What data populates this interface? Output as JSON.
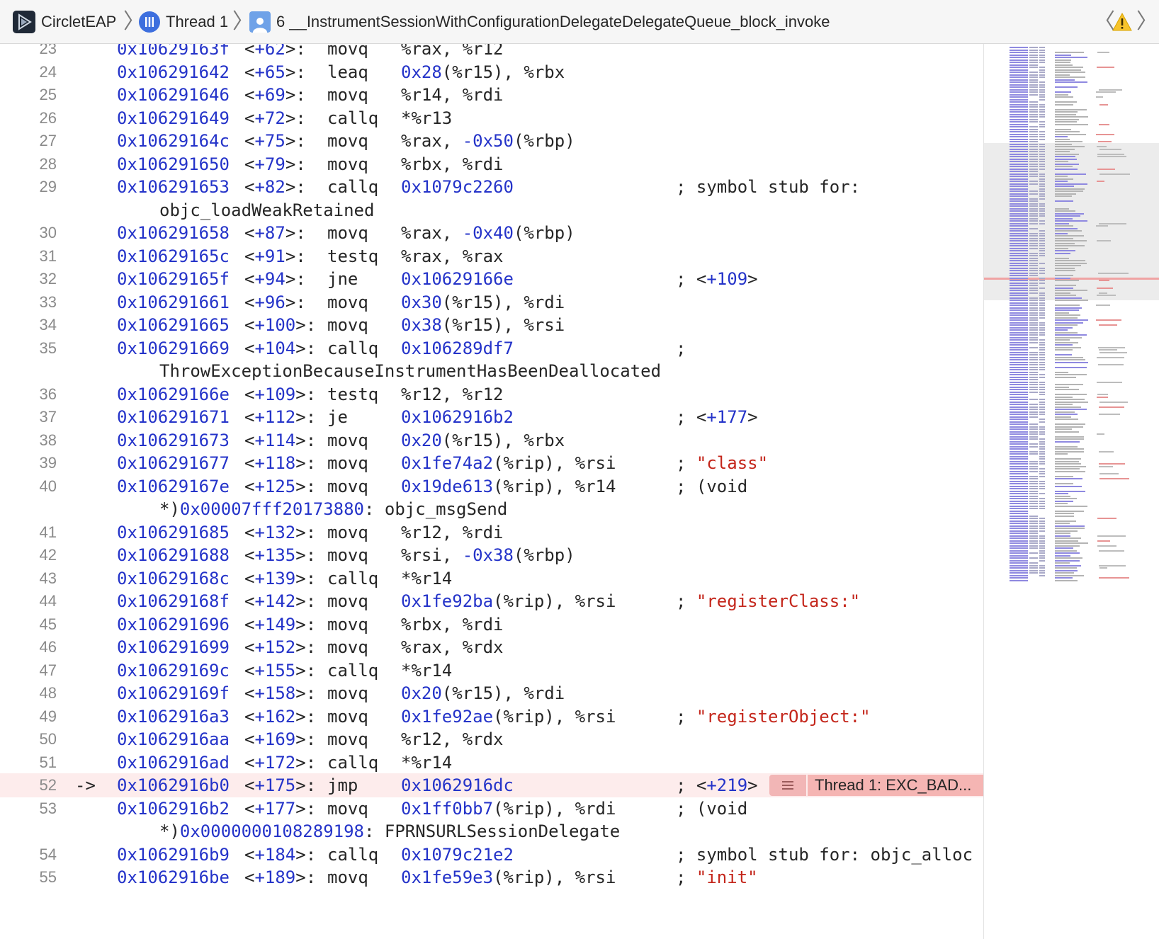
{
  "jumpbar": {
    "app_name": "CircletEAP",
    "thread_label": "Thread 1",
    "frame_label": "6 __InstrumentSessionWithConfigurationDelegateDelegateQueue_block_invoke"
  },
  "colors": {
    "address": "#2433c9",
    "string": "#c4261b",
    "highlight_row": "#fdecec",
    "error_badge": "#f5b5b3"
  },
  "lines": [
    {
      "num": "23",
      "addr": "0x10629163f",
      "off": "62",
      "mn": "movq",
      "ops": [
        [
          "t",
          "%rax, %r12"
        ]
      ]
    },
    {
      "num": "24",
      "addr": "0x106291642",
      "off": "65",
      "mn": "leaq",
      "ops": [
        [
          "n",
          "0x28"
        ],
        [
          "t",
          "(%r15), %rbx"
        ]
      ]
    },
    {
      "num": "25",
      "addr": "0x106291646",
      "off": "69",
      "mn": "movq",
      "ops": [
        [
          "t",
          "%r14, %rdi"
        ]
      ]
    },
    {
      "num": "26",
      "addr": "0x106291649",
      "off": "72",
      "mn": "callq",
      "ops": [
        [
          "t",
          "*%r13"
        ]
      ]
    },
    {
      "num": "27",
      "addr": "0x10629164c",
      "off": "75",
      "mn": "movq",
      "ops": [
        [
          "t",
          "%rax, "
        ],
        [
          "n",
          "-0x50"
        ],
        [
          "t",
          "(%rbp)"
        ]
      ]
    },
    {
      "num": "28",
      "addr": "0x106291650",
      "off": "79",
      "mn": "movq",
      "ops": [
        [
          "t",
          "%rbx, %rdi"
        ]
      ]
    },
    {
      "num": "29",
      "addr": "0x106291653",
      "off": "82",
      "mn": "callq",
      "ops": [
        [
          "n",
          "0x1079c2260"
        ]
      ],
      "cmt": [
        [
          "t",
          "; symbol stub for:"
        ]
      ],
      "cont": [
        [
          "t",
          "objc_loadWeakRetained"
        ]
      ]
    },
    {
      "num": "30",
      "addr": "0x106291658",
      "off": "87",
      "mn": "movq",
      "ops": [
        [
          "t",
          "%rax, "
        ],
        [
          "n",
          "-0x40"
        ],
        [
          "t",
          "(%rbp)"
        ]
      ]
    },
    {
      "num": "31",
      "addr": "0x10629165c",
      "off": "91",
      "mn": "testq",
      "ops": [
        [
          "t",
          "%rax, %rax"
        ]
      ]
    },
    {
      "num": "32",
      "addr": "0x10629165f",
      "off": "94",
      "mn": "jne",
      "ops": [
        [
          "n",
          "0x10629166e"
        ]
      ],
      "cmt": [
        [
          "t",
          "; <"
        ],
        [
          "n",
          "+109"
        ],
        [
          "t",
          ">"
        ]
      ]
    },
    {
      "num": "33",
      "addr": "0x106291661",
      "off": "96",
      "mn": "movq",
      "ops": [
        [
          "n",
          "0x30"
        ],
        [
          "t",
          "(%r15), %rdi"
        ]
      ]
    },
    {
      "num": "34",
      "addr": "0x106291665",
      "off": "100",
      "mn": "movq",
      "ops": [
        [
          "n",
          "0x38"
        ],
        [
          "t",
          "(%r15), %rsi"
        ]
      ]
    },
    {
      "num": "35",
      "addr": "0x106291669",
      "off": "104",
      "mn": "callq",
      "ops": [
        [
          "n",
          "0x106289df7"
        ]
      ],
      "cmt": [
        [
          "t",
          ";"
        ]
      ],
      "cont": [
        [
          "t",
          "ThrowExceptionBecauseInstrumentHasBeenDeallocated"
        ]
      ]
    },
    {
      "num": "36",
      "addr": "0x10629166e",
      "off": "109",
      "mn": "testq",
      "ops": [
        [
          "t",
          "%r12, %r12"
        ]
      ]
    },
    {
      "num": "37",
      "addr": "0x106291671",
      "off": "112",
      "mn": "je",
      "ops": [
        [
          "n",
          "0x1062916b2"
        ]
      ],
      "cmt": [
        [
          "t",
          "; <"
        ],
        [
          "n",
          "+177"
        ],
        [
          "t",
          ">"
        ]
      ]
    },
    {
      "num": "38",
      "addr": "0x106291673",
      "off": "114",
      "mn": "movq",
      "ops": [
        [
          "n",
          "0x20"
        ],
        [
          "t",
          "(%r15), %rbx"
        ]
      ]
    },
    {
      "num": "39",
      "addr": "0x106291677",
      "off": "118",
      "mn": "movq",
      "ops": [
        [
          "n",
          "0x1fe74a2"
        ],
        [
          "t",
          "(%rip), %rsi"
        ]
      ],
      "cmt": [
        [
          "t",
          "; "
        ],
        [
          "s",
          "\"class\""
        ]
      ]
    },
    {
      "num": "40",
      "addr": "0x10629167e",
      "off": "125",
      "mn": "movq",
      "ops": [
        [
          "n",
          "0x19de613"
        ],
        [
          "t",
          "(%rip), %r14"
        ]
      ],
      "cmt": [
        [
          "t",
          "; (void"
        ]
      ],
      "cont": [
        [
          "t",
          "*)"
        ],
        [
          "n",
          "0x00007fff20173880"
        ],
        [
          "t",
          ": objc_msgSend"
        ]
      ]
    },
    {
      "num": "41",
      "addr": "0x106291685",
      "off": "132",
      "mn": "movq",
      "ops": [
        [
          "t",
          "%r12, %rdi"
        ]
      ]
    },
    {
      "num": "42",
      "addr": "0x106291688",
      "off": "135",
      "mn": "movq",
      "ops": [
        [
          "t",
          "%rsi, "
        ],
        [
          "n",
          "-0x38"
        ],
        [
          "t",
          "(%rbp)"
        ]
      ]
    },
    {
      "num": "43",
      "addr": "0x10629168c",
      "off": "139",
      "mn": "callq",
      "ops": [
        [
          "t",
          "*%r14"
        ]
      ]
    },
    {
      "num": "44",
      "addr": "0x10629168f",
      "off": "142",
      "mn": "movq",
      "ops": [
        [
          "n",
          "0x1fe92ba"
        ],
        [
          "t",
          "(%rip), %rsi"
        ]
      ],
      "cmt": [
        [
          "t",
          "; "
        ],
        [
          "s",
          "\"registerClass:\""
        ]
      ]
    },
    {
      "num": "45",
      "addr": "0x106291696",
      "off": "149",
      "mn": "movq",
      "ops": [
        [
          "t",
          "%rbx, %rdi"
        ]
      ]
    },
    {
      "num": "46",
      "addr": "0x106291699",
      "off": "152",
      "mn": "movq",
      "ops": [
        [
          "t",
          "%rax, %rdx"
        ]
      ]
    },
    {
      "num": "47",
      "addr": "0x10629169c",
      "off": "155",
      "mn": "callq",
      "ops": [
        [
          "t",
          "*%r14"
        ]
      ]
    },
    {
      "num": "48",
      "addr": "0x10629169f",
      "off": "158",
      "mn": "movq",
      "ops": [
        [
          "n",
          "0x20"
        ],
        [
          "t",
          "(%r15), %rdi"
        ]
      ]
    },
    {
      "num": "49",
      "addr": "0x1062916a3",
      "off": "162",
      "mn": "movq",
      "ops": [
        [
          "n",
          "0x1fe92ae"
        ],
        [
          "t",
          "(%rip), %rsi"
        ]
      ],
      "cmt": [
        [
          "t",
          "; "
        ],
        [
          "s",
          "\"registerObject:\""
        ]
      ]
    },
    {
      "num": "50",
      "addr": "0x1062916aa",
      "off": "169",
      "mn": "movq",
      "ops": [
        [
          "t",
          "%r12, %rdx"
        ]
      ]
    },
    {
      "num": "51",
      "addr": "0x1062916ad",
      "off": "172",
      "mn": "callq",
      "ops": [
        [
          "t",
          "*%r14"
        ]
      ]
    },
    {
      "num": "52",
      "addr": "0x1062916b0",
      "off": "175",
      "mn": "jmp",
      "ops": [
        [
          "n",
          "0x1062916dc"
        ]
      ],
      "cmt": [
        [
          "t",
          "; <"
        ],
        [
          "n",
          "+219"
        ],
        [
          "t",
          ">"
        ]
      ],
      "current": true,
      "arrow": "->",
      "badge": "Thread 1: EXC_BAD..."
    },
    {
      "num": "53",
      "addr": "0x1062916b2",
      "off": "177",
      "mn": "movq",
      "ops": [
        [
          "n",
          "0x1ff0bb7"
        ],
        [
          "t",
          "(%rip), %rdi"
        ]
      ],
      "cmt": [
        [
          "t",
          "; (void"
        ]
      ],
      "cont": [
        [
          "t",
          "*)"
        ],
        [
          "n",
          "0x0000000108289198"
        ],
        [
          "t",
          ": FPRNSURLSessionDelegate"
        ]
      ]
    },
    {
      "num": "54",
      "addr": "0x1062916b9",
      "off": "184",
      "mn": "callq",
      "ops": [
        [
          "n",
          "0x1079c21e2"
        ]
      ],
      "cmt": [
        [
          "t",
          "; symbol stub for: objc_alloc"
        ]
      ]
    },
    {
      "num": "55",
      "addr": "0x1062916be",
      "off": "189",
      "mn": "movq",
      "ops": [
        [
          "n",
          "0x1fe59e3"
        ],
        [
          "t",
          "(%rip), %rsi"
        ]
      ],
      "cmt": [
        [
          "t",
          "; "
        ],
        [
          "s",
          "\"init\""
        ]
      ]
    }
  ]
}
